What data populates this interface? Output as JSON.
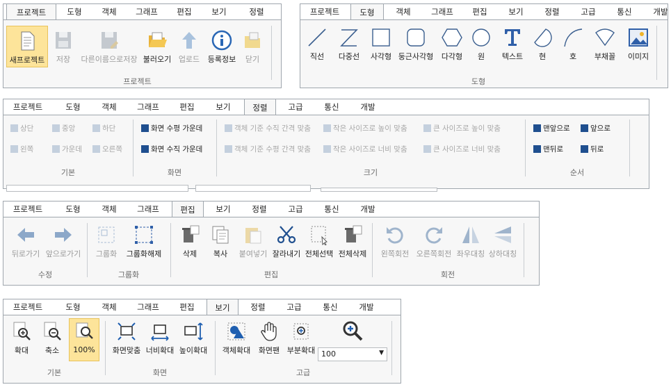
{
  "tabs_main": [
    "프로젝트",
    "도형",
    "객체",
    "그래프",
    "편집",
    "보기",
    "정렬"
  ],
  "tabs_full": [
    "프로젝트",
    "도형",
    "객체",
    "그래프",
    "편집",
    "보기",
    "정렬",
    "고급",
    "통신",
    "개발"
  ],
  "p1": {
    "buttons": [
      "새프로젝트",
      "저장",
      "다른이름으로저장",
      "불러오기",
      "업로드",
      "등록정보",
      "닫기"
    ],
    "group": "프로젝트"
  },
  "p2": {
    "buttons": [
      "직선",
      "다중선",
      "사각형",
      "둥근사각형",
      "다각형",
      "원",
      "텍스트",
      "현",
      "호",
      "부채꼴",
      "이미지"
    ],
    "group": "도형"
  },
  "p3": {
    "basic": [
      "상단",
      "중앙",
      "하단",
      "왼쪽",
      "가운데",
      "오른쪽"
    ],
    "screen": [
      "화면 수평 가운데",
      "화면 수직 가운데"
    ],
    "size": [
      "객체 기준 수직 간격 맞춤",
      "작은 사이즈로 높이 맞춤",
      "큰 사이즈로 높이 맞춤",
      "객체 기준 수평 간격 맞춤",
      "작은 사이즈로 너비 맞춤",
      "큰 사이즈로 너비 맞춤"
    ],
    "order": [
      "맨앞으로",
      "앞으로",
      "맨뒤로",
      "뒤로"
    ],
    "groups": [
      "기본",
      "화면",
      "크기",
      "순서"
    ]
  },
  "p4": {
    "edit_buttons": [
      "뒤로가기",
      "앞으로가기",
      "그룹화",
      "그룹화해제",
      "삭제",
      "복사",
      "붙여넣기",
      "잘라내기",
      "전체선택",
      "전체삭제",
      "왼쪽회전",
      "오른쪽회전",
      "좌우대칭",
      "상하대칭"
    ],
    "groups": [
      "수정",
      "그룹화",
      "편집",
      "회전"
    ]
  },
  "p5": {
    "buttons": [
      "확대",
      "축소",
      "100%",
      "화면맞춤",
      "너비확대",
      "높이확대",
      "객체확대",
      "화면팬",
      "부분확대"
    ],
    "zoom_value": "100",
    "groups": [
      "기본",
      "화면",
      "고급"
    ]
  },
  "colors": {
    "accent": "#2f5fa8",
    "selected": "#fde49a",
    "disabled": "#b9c3cf"
  }
}
